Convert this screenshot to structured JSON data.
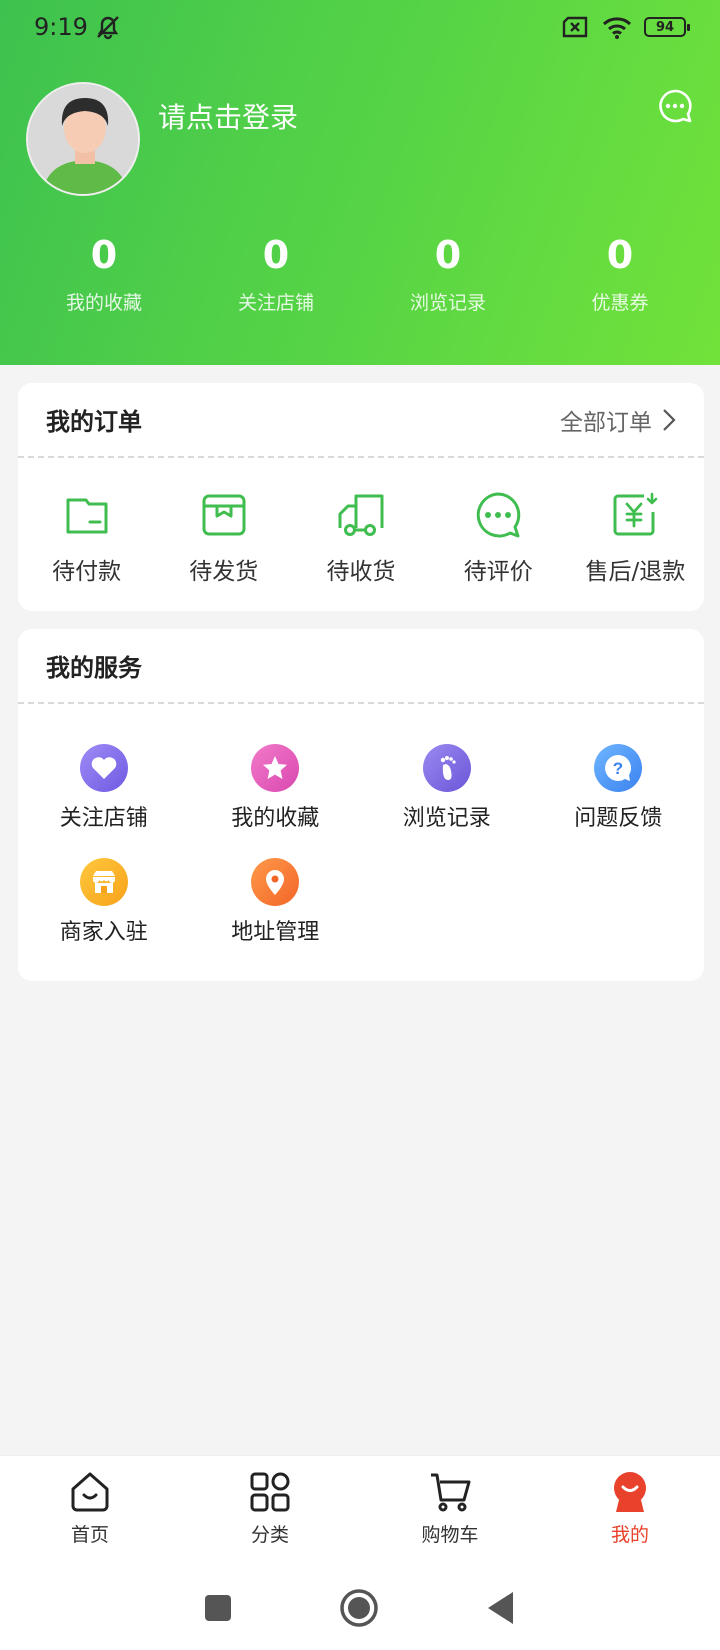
{
  "status_bar": {
    "time": "9:19",
    "battery": "94"
  },
  "profile": {
    "login_text": "请点击登录"
  },
  "stats": [
    {
      "value": "0",
      "label": "我的收藏"
    },
    {
      "value": "0",
      "label": "关注店铺"
    },
    {
      "value": "0",
      "label": "浏览记录"
    },
    {
      "value": "0",
      "label": "优惠券"
    }
  ],
  "orders": {
    "title": "我的订单",
    "all_label": "全部订单",
    "items": [
      {
        "label": "待付款",
        "icon": "wallet-icon"
      },
      {
        "label": "待发货",
        "icon": "package-icon"
      },
      {
        "label": "待收货",
        "icon": "truck-icon"
      },
      {
        "label": "待评价",
        "icon": "chat-bubble-icon"
      },
      {
        "label": "售后/退款",
        "icon": "refund-icon"
      }
    ]
  },
  "services": {
    "title": "我的服务",
    "items": [
      {
        "label": "关注店铺",
        "icon": "heart-icon"
      },
      {
        "label": "我的收藏",
        "icon": "star-icon"
      },
      {
        "label": "浏览记录",
        "icon": "footprint-icon"
      },
      {
        "label": "问题反馈",
        "icon": "question-icon"
      },
      {
        "label": "商家入驻",
        "icon": "shop-icon"
      },
      {
        "label": "地址管理",
        "icon": "location-pin-icon"
      }
    ]
  },
  "tabbar": {
    "items": [
      {
        "label": "首页",
        "icon": "home-icon"
      },
      {
        "label": "分类",
        "icon": "grid-icon"
      },
      {
        "label": "购物车",
        "icon": "cart-icon"
      },
      {
        "label": "我的",
        "icon": "profile-mascot-icon",
        "active": true
      }
    ]
  },
  "colors": {
    "brand_green": "#4fcc4a",
    "icon_green": "#3fbd4f",
    "active_red": "#e8412c"
  }
}
